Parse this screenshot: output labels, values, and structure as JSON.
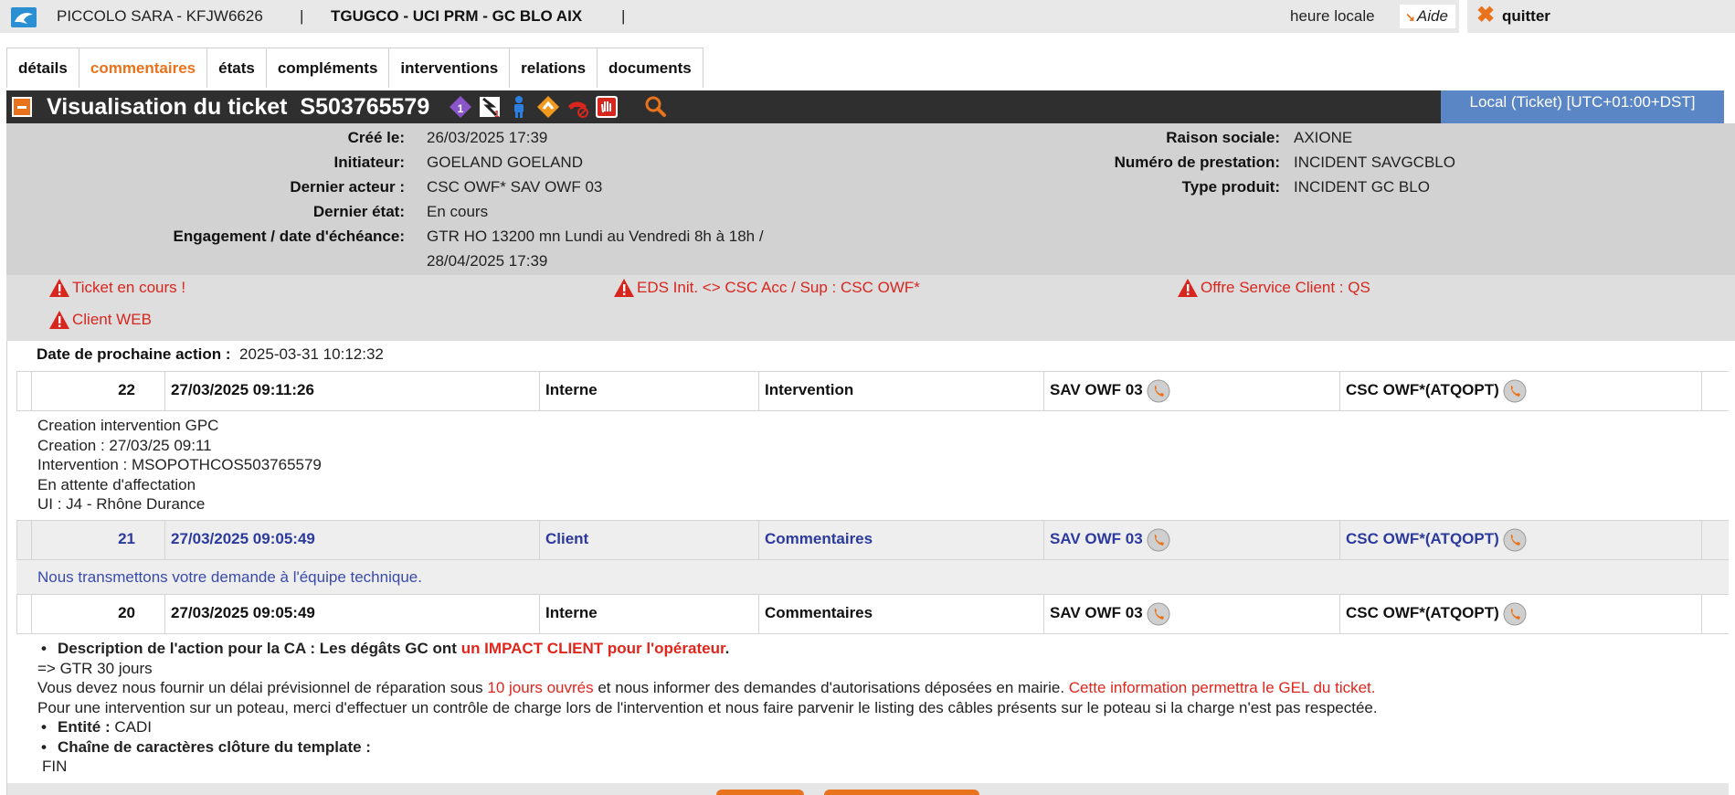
{
  "topbar": {
    "user": "PICCOLO SARA - KFJW6626",
    "separator": "|",
    "site": "TGUGCO - UCI PRM - GC BLO AIX",
    "heure_locale": "heure locale",
    "aide": "Aide",
    "quitter": "quitter"
  },
  "tabs": [
    "détails",
    "commentaires",
    "états",
    "compléments",
    "interventions",
    "relations",
    "documents"
  ],
  "active_tab": "commentaires",
  "header": {
    "title": "Visualisation du ticket",
    "ticket_id": "S503765579",
    "timezone": "Local (Ticket) [UTC+01:00+DST]"
  },
  "info": {
    "cree_le_label": "Créé le:",
    "cree_le": "26/03/2025 17:39",
    "initiateur_label": "Initiateur:",
    "initiateur": "GOELAND GOELAND",
    "dernier_acteur_label": "Dernier acteur :",
    "dernier_acteur": "CSC OWF* SAV OWF 03",
    "dernier_etat_label": "Dernier état:",
    "dernier_etat": "En cours",
    "engagement_label": "Engagement / date d'échéance:",
    "engagement_line1": "GTR HO 13200 mn Lundi au Vendredi 8h à 18h /",
    "engagement_line2": "28/04/2025 17:39",
    "raison_sociale_label": "Raison sociale:",
    "raison_sociale": "AXIONE",
    "numero_prestation_label": "Numéro de prestation:",
    "numero_prestation": "INCIDENT SAVGCBLO",
    "type_produit_label": "Type produit:",
    "type_produit": "INCIDENT GC BLO"
  },
  "alerts": [
    "Ticket en cours !",
    "EDS Init. <> CSC Acc / Sup : CSC OWF*",
    "Offre Service Client : QS",
    "Client WEB"
  ],
  "next_action": {
    "label": "Date de prochaine action :",
    "value": "2025-03-31 10:12:32"
  },
  "comments": [
    {
      "num": "22",
      "date": "27/03/2025 09:11:26",
      "visibility": "Interne",
      "type": "Intervention",
      "from": "SAV OWF 03",
      "to": "CSC OWF*(ATQOPT)",
      "lines": [
        "Creation intervention GPC",
        "Creation : 27/03/25 09:11",
        "Intervention : MSOPOTHCOS503765579",
        "En attente d'affectation",
        "UI : J4 - Rhône Durance"
      ]
    },
    {
      "num": "21",
      "date": "27/03/2025 09:05:49",
      "visibility": "Client",
      "type": "Commentaires",
      "from": "SAV OWF 03",
      "to": "CSC OWF*(ATQOPT)",
      "text": "Nous transmettons votre demande à l'équipe technique."
    },
    {
      "num": "20",
      "date": "27/03/2025 09:05:49",
      "visibility": "Interne",
      "type": "Commentaires",
      "from": "SAV OWF 03",
      "to": "CSC OWF*(ATQOPT)",
      "desc_bold": "Description de l'action pour la CA : Les dégâts GC ont ",
      "desc_red": "un IMPACT CLIENT pour l'opérateur",
      "desc_end": ".",
      "gtr": "=> GTR 30 jours",
      "p1_a": "Vous devez nous fournir un délai prévisionnel de réparation sous ",
      "p1_red": "10 jours ouvrés",
      "p1_b": " et nous informer des demandes d'autorisations déposées en mairie. ",
      "p1_red2": "Cette information permettra le GEL du ticket.",
      "p2": "Pour une intervention sur un poteau, merci d'effectuer un contrôle de charge lors de l'intervention et nous faire parvenir le listing des câbles présents sur le poteau si la charge n'est pas respectée.",
      "entite_label": "Entité :",
      "entite": " CADI",
      "chaine_label": "Chaîne de caractères clôture du template :",
      "fin": "FIN"
    }
  ],
  "colors": {
    "accent": "#e8731c",
    "header_bg": "#2f2f2f",
    "timezone_bg": "#5b86c5",
    "alert_red": "#d7261e",
    "client_blue": "#2b3a9c"
  }
}
